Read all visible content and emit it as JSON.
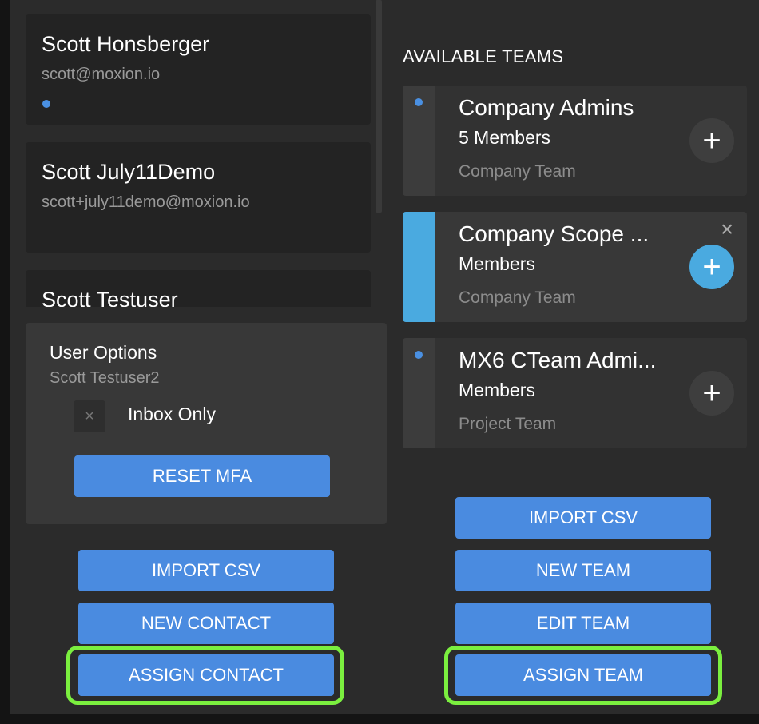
{
  "contacts": [
    {
      "name": "Scott Honsberger",
      "email": "scott@moxion.io",
      "unread": true
    },
    {
      "name": "Scott July11Demo",
      "email": "scott+july11demo@moxion.io",
      "unread": false
    },
    {
      "name": "Scott Testuser",
      "email": "",
      "unread": false
    }
  ],
  "user_options": {
    "title": "User Options",
    "subtitle": "Scott Testuser2",
    "checkbox_icon": "×",
    "checkbox_label": "Inbox Only",
    "reset_mfa_label": "RESET MFA"
  },
  "left_actions": {
    "import_csv": "IMPORT CSV",
    "new_contact": "NEW CONTACT",
    "assign_contact": "ASSIGN CONTACT"
  },
  "teams_panel": {
    "title": "AVAILABLE TEAMS",
    "teams": [
      {
        "name": "Company Admins",
        "members": "5 Members",
        "type": "Company Team",
        "selected": false
      },
      {
        "name": "Company Scope ...",
        "members": "Members",
        "type": "Company Team",
        "selected": true
      },
      {
        "name": "MX6 CTeam Admi...",
        "members": "Members",
        "type": "Project Team",
        "selected": false
      }
    ],
    "add_icon": "+",
    "close_icon": "×"
  },
  "right_actions": {
    "import_csv": "IMPORT CSV",
    "new_team": "NEW TEAM",
    "edit_team": "EDIT TEAM",
    "assign_team": "ASSIGN TEAM"
  },
  "colors": {
    "accent": "#4a8be0",
    "selected_strip": "#4aaae0",
    "highlight": "#7bef3f",
    "dot": "#4a90e2"
  }
}
